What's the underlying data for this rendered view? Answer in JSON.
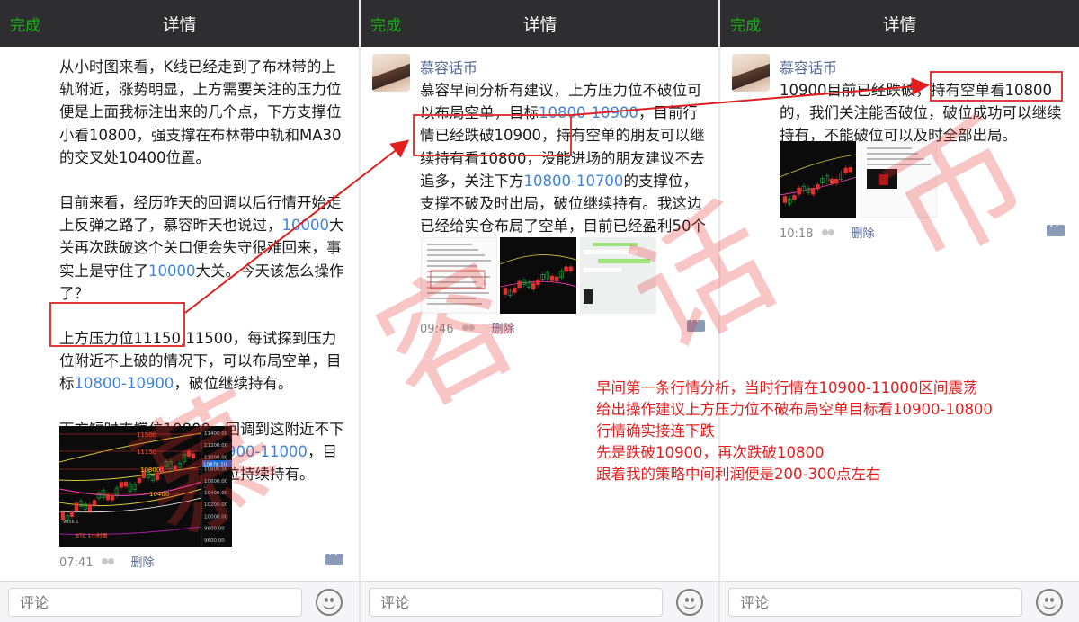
{
  "nav": {
    "done_label": "完成",
    "title": "详情"
  },
  "panel1": {
    "paragraphs": [
      "从小时图来看，K线已经走到了布林带的上轨附近，涨势明显，上方需要关注的压力位便是上面我标注出来的几个点，下方支撑位小看10800，强支撑在布林带中轨和MA30的交叉处10400位置。",
      "目前来看，经历昨天的回调以后行情开始走上反弹之路了，慕容昨天也说过，10000大关再次跌破这个关口便会失守很难回来，事实上是守住了10000大关。今天该怎么操作了？",
      "上方压力位11150,11500，每试探到压力位附近不上破的情况下，可以布局空单，目标10800-10900，破位继续持有。",
      "下方短时支撑位10800，回调到这附近不下破可以布局多单，目标10900-11000，目标站稳看11150，持续破位持续持有。"
    ],
    "chart": {
      "price_labels": [
        "11400.00",
        "11200.00",
        "11000.00",
        "10800.00",
        "10600.00",
        "10400.00",
        "10200.00",
        "10000.00",
        "9800.00",
        "9600.00"
      ],
      "level_labels": [
        "11500",
        "11150",
        "10800",
        "10400"
      ],
      "current_price": "10878.10",
      "low_label": "9856.1",
      "caption": "BTC 1小时图"
    },
    "time": "07:41",
    "delete_label": "删除"
  },
  "panel2": {
    "author": "慕容话币",
    "text": "慕容早间分析有建议，上方压力位不破位可以布局空单，目标10800-10900，目前行情已经跌破10900，持有空单的朋友可以继续持有看10800，没能进场的朋友建议不去追多，关注下方10800-10700的支撑位，支撑不破及时出局，破位继续持有。我这边已经给实仓布局了空单，目前已经盈利50个点。",
    "time": "09:46",
    "delete_label": "删除"
  },
  "panel3": {
    "author": "慕容话币",
    "text": "10900目前已经跌破，持有空单看10800的，我们关注能否破位，破位成功可以继续持有，不能破位可以及时全部出局。",
    "time": "10:18",
    "delete_label": "删除"
  },
  "comment_placeholder": "评论",
  "annotation": [
    "早间第一条行情分析，当时行情在10900-11000区间震荡",
    "给出操作建议上方压力位不破布局空单目标看10900-10800",
    "行情确实接连下跌",
    "先是跌破10900，再次跌破10800",
    "跟着我的策略中间利润便是200-300点左右"
  ],
  "watermark": [
    "慕",
    "容",
    "话",
    "币"
  ],
  "colors": {
    "nav_bg": "#2e2e30",
    "done_green": "#1aad19",
    "link_blue": "#3f84d9",
    "author_blue": "#576b95",
    "annot_red": "#e02020"
  }
}
